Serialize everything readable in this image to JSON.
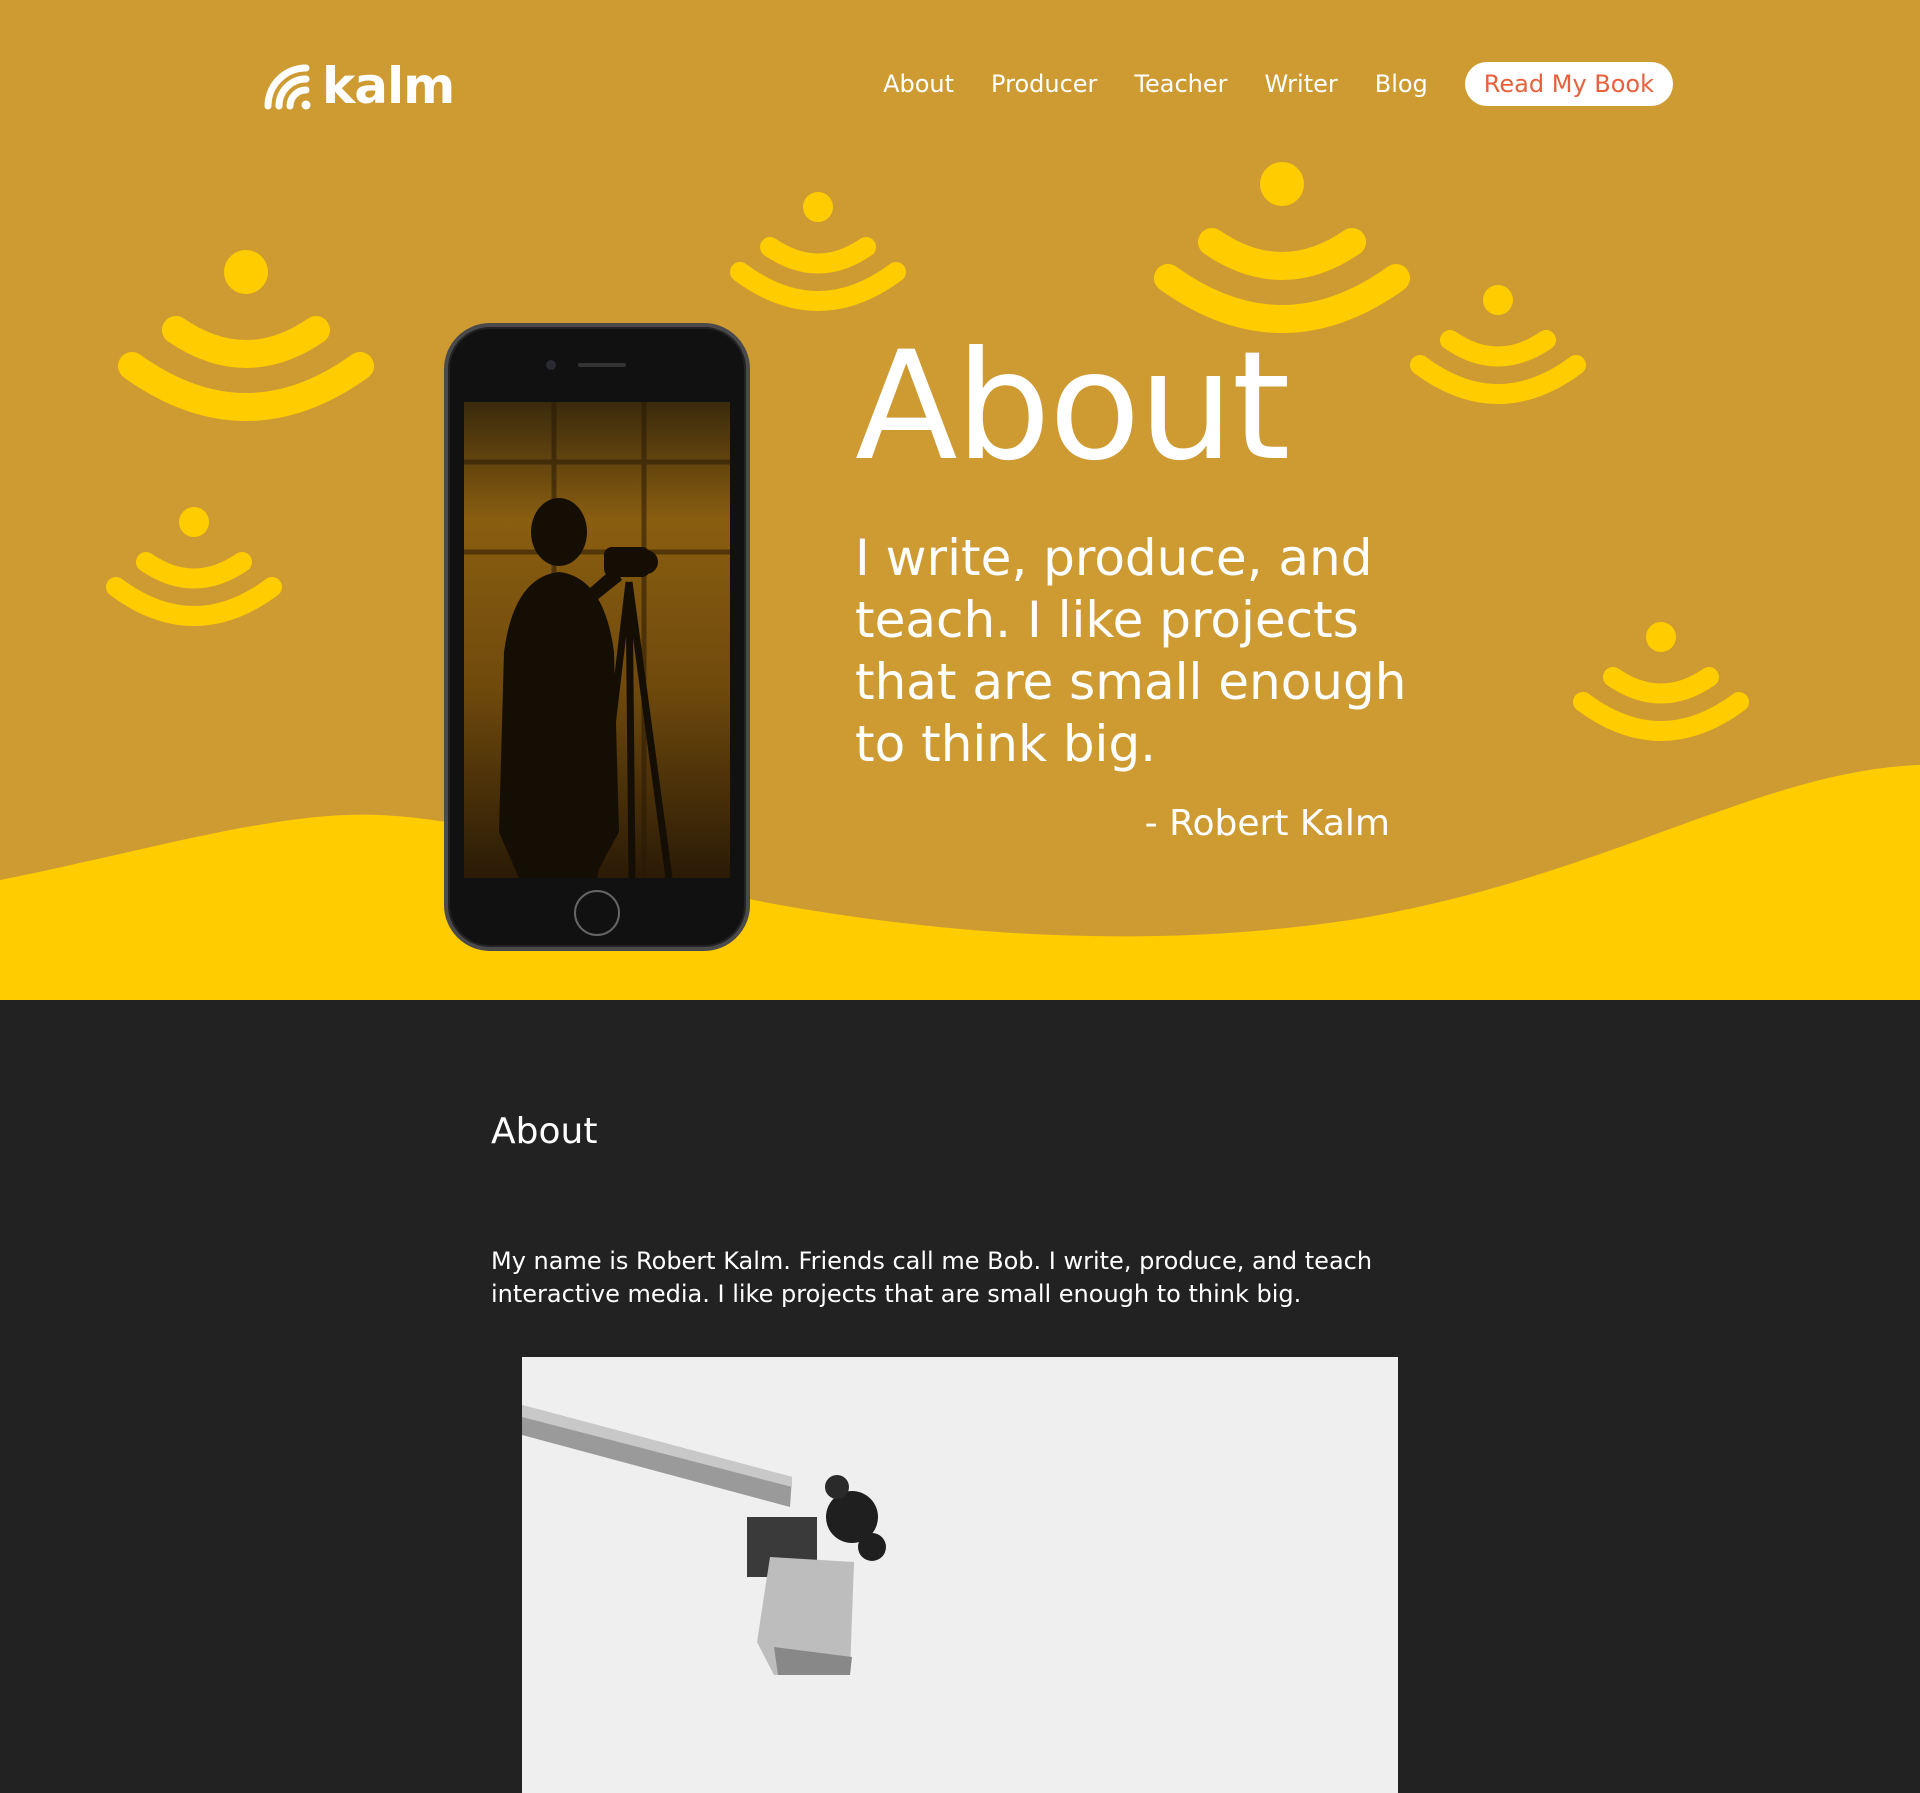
{
  "brand": {
    "name": "kalm",
    "logo_icon": "signal-waves-icon"
  },
  "nav": {
    "items": [
      {
        "label": "About"
      },
      {
        "label": "Producer"
      },
      {
        "label": "Teacher"
      },
      {
        "label": "Writer"
      },
      {
        "label": "Blog"
      }
    ],
    "cta_label": "Read My Book"
  },
  "hero": {
    "title": "About",
    "quote": "I write, produce, and teach. I like projects that are small enough to think big.",
    "author": "- Robert Kalm"
  },
  "about": {
    "heading": "About",
    "body": "My name is Robert Kalm. Friends call me Bob. I write, produce, and teach interactive media. I like projects that are small enough to think big."
  },
  "colors": {
    "hero_bg": "#CE9B33",
    "accent_yellow": "#FFCC00",
    "content_bg": "#222222",
    "cta_text": "#E8603C"
  }
}
